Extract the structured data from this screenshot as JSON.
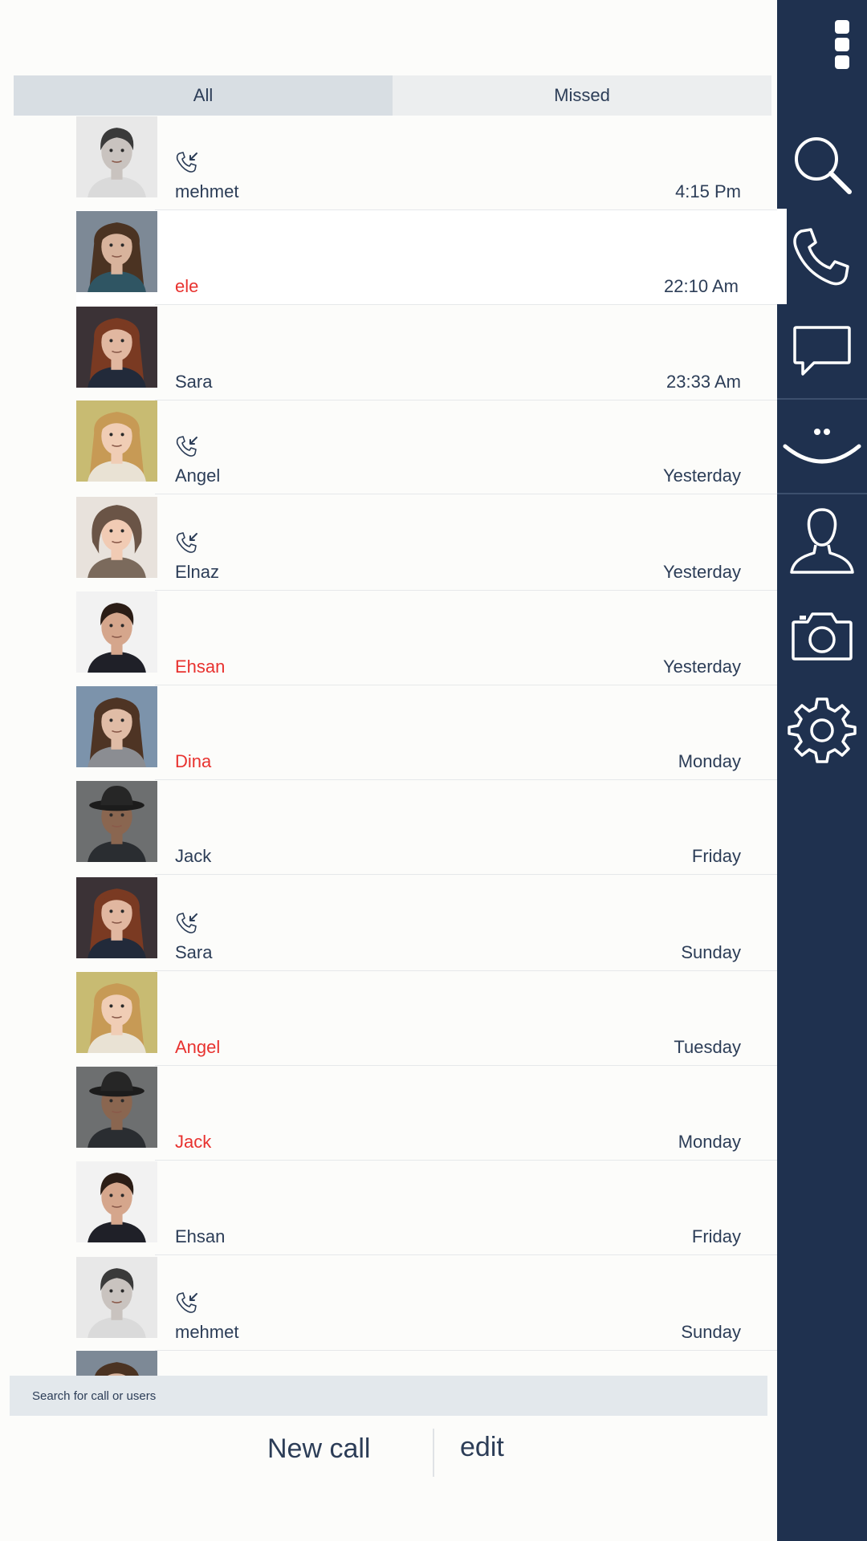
{
  "tabs": [
    {
      "label": "All",
      "active": true
    },
    {
      "label": "Missed",
      "active": false
    }
  ],
  "calls": [
    {
      "name": "mehmet",
      "time": "4:15 Pm",
      "missed": false,
      "call_icon": true,
      "avatar": "man-bw"
    },
    {
      "name": "ele",
      "time": "22:10 Am",
      "missed": true,
      "call_icon": false,
      "avatar": "woman-scarf"
    },
    {
      "name": "Sara",
      "time": "23:33 Am",
      "missed": false,
      "call_icon": false,
      "avatar": "woman-redhair"
    },
    {
      "name": "Angel",
      "time": "Yesterday",
      "missed": false,
      "call_icon": true,
      "avatar": "woman-blonde"
    },
    {
      "name": "Elnaz",
      "time": "Yesterday",
      "missed": false,
      "call_icon": true,
      "avatar": "baby-hat"
    },
    {
      "name": "Ehsan",
      "time": "Yesterday",
      "missed": true,
      "call_icon": false,
      "avatar": "man-dark"
    },
    {
      "name": "Dina",
      "time": "Monday",
      "missed": true,
      "call_icon": false,
      "avatar": "woman-curly"
    },
    {
      "name": "Jack",
      "time": "Friday",
      "missed": false,
      "call_icon": false,
      "avatar": "man-hat"
    },
    {
      "name": "Sara",
      "time": "Sunday",
      "missed": false,
      "call_icon": true,
      "avatar": "woman-redhair"
    },
    {
      "name": "Angel",
      "time": "Tuesday",
      "missed": true,
      "call_icon": false,
      "avatar": "woman-blonde"
    },
    {
      "name": "Jack",
      "time": "Monday",
      "missed": true,
      "call_icon": false,
      "avatar": "man-hat"
    },
    {
      "name": "Ehsan",
      "time": "Friday",
      "missed": false,
      "call_icon": false,
      "avatar": "man-dark"
    },
    {
      "name": "mehmet",
      "time": "Sunday",
      "missed": false,
      "call_icon": true,
      "avatar": "man-bw"
    },
    {
      "name": "",
      "time": "",
      "missed": false,
      "call_icon": false,
      "avatar": "woman-scarf"
    }
  ],
  "search": {
    "placeholder": "Search for call or users"
  },
  "actions": {
    "new_call": "New call",
    "edit": "edit"
  },
  "sidebar": {
    "items": [
      {
        "icon": "search-icon"
      },
      {
        "icon": "phone-icon",
        "active": true
      },
      {
        "icon": "chat-icon"
      },
      {
        "icon": "smiley-icon"
      },
      {
        "icon": "contact-icon"
      },
      {
        "icon": "camera-icon"
      },
      {
        "icon": "settings-icon"
      }
    ]
  },
  "colors": {
    "sidebar": "#1f314f",
    "text": "#2c3d57",
    "missed": "#e8322f",
    "tab_active": "#d8dee3",
    "tab_inactive": "#eceeef"
  }
}
